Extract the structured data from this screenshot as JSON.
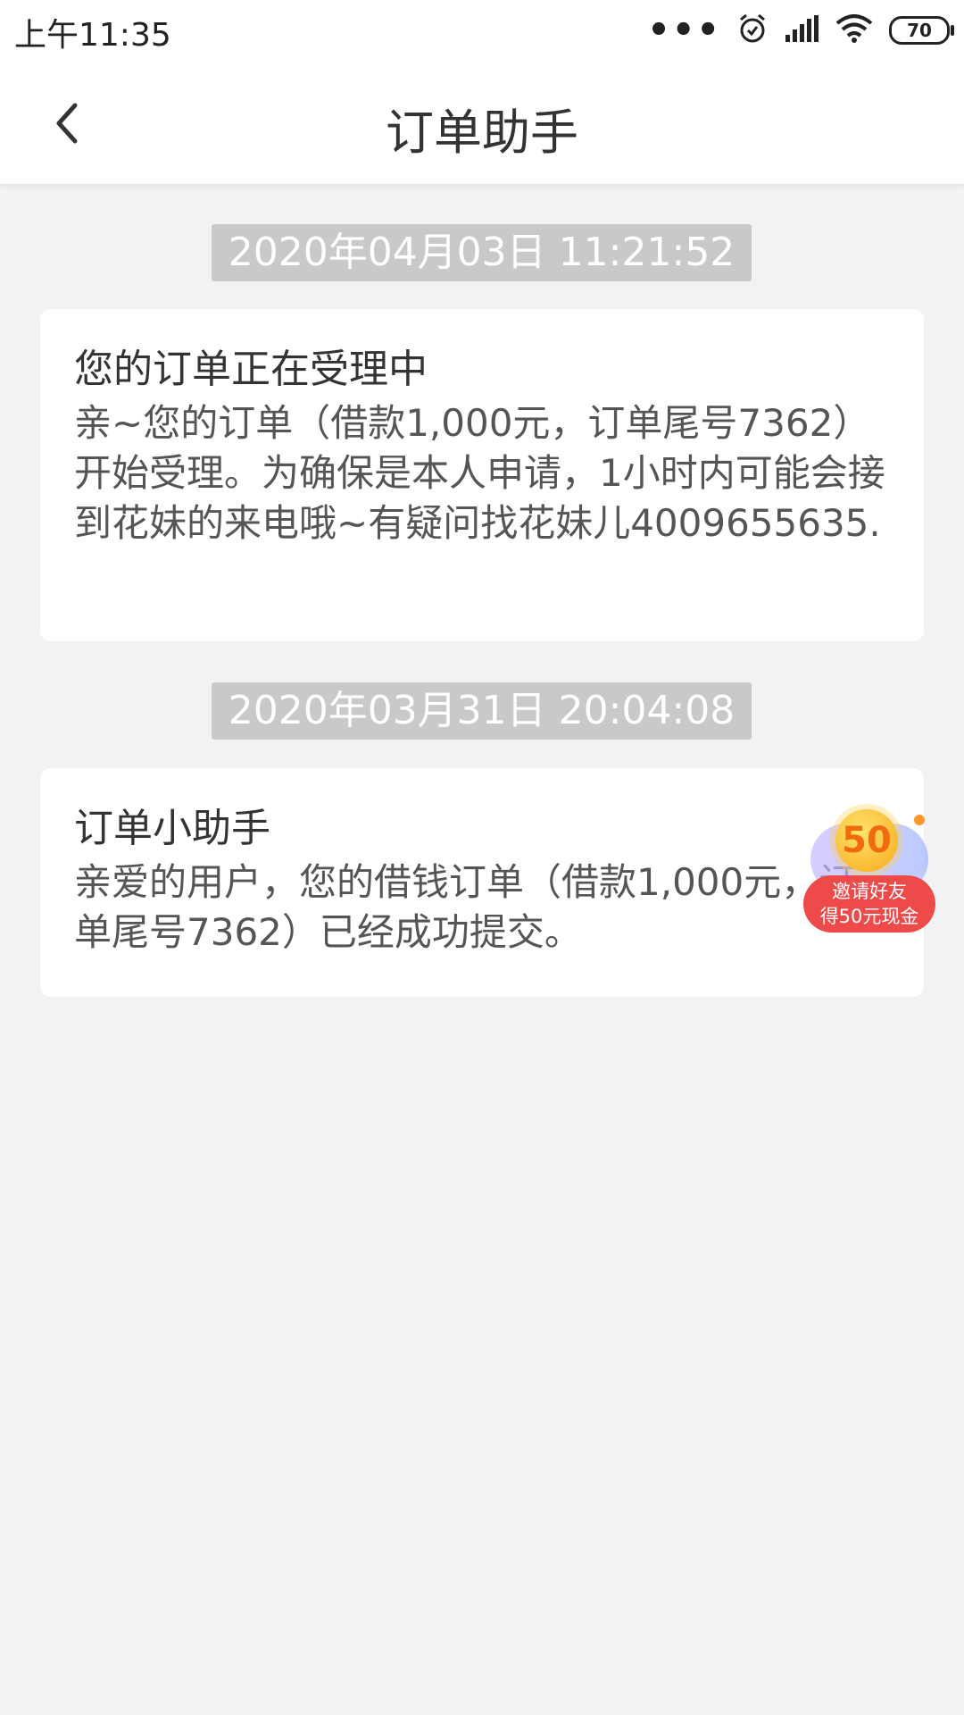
{
  "status_bar": {
    "time": "上午11:35",
    "battery_level": "70",
    "icons": [
      "more-dots-icon",
      "alarm-icon",
      "signal-icon",
      "wifi-icon",
      "battery-icon"
    ]
  },
  "header": {
    "title": "订单助手",
    "back_icon": "chevron-left-icon"
  },
  "messages": [
    {
      "timestamp": "2020年04月03日 11:21:52",
      "title": " 您的订单正在受理中",
      "body": "亲~您的订单（借款1,000元，订单尾号7362）开始受理。为确保是本人申请，1小时内可能会接到花妹的来电哦~有疑问找花妹儿4009655635."
    },
    {
      "timestamp": "2020年03月31日 20:04:08",
      "title": "订单小助手",
      "body": "亲爱的用户，您的借钱订单（借款1,000元，订单尾号7362）已经成功提交。"
    }
  ],
  "promo": {
    "coin_value": "50",
    "line1": "邀请好友",
    "line2": "得50元现金"
  },
  "colors": {
    "background": "#f2f2f2",
    "timestamp_bg": "#c9c9c9",
    "promo_red": "#ef4a4a",
    "coin_gold": "#f7a91a"
  }
}
